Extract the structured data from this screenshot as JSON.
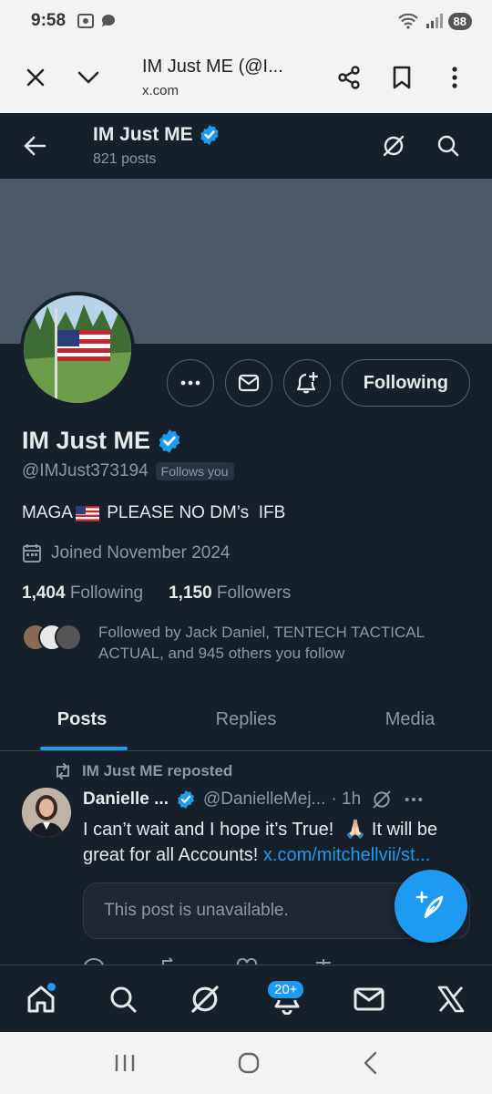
{
  "status_bar": {
    "time": "9:58",
    "battery": "88"
  },
  "browser": {
    "title": "IM Just ME (@I...",
    "url": "x.com"
  },
  "header": {
    "name": "IM Just ME",
    "posts": "821 posts"
  },
  "profile": {
    "name": "IM Just ME",
    "handle": "@IMJust373194",
    "follows_you": "Follows you",
    "bio_pre": "MAGA",
    "bio_post": " PLEASE NO DM’s  IFB",
    "joined": "Joined November 2024",
    "following_count": "1,404",
    "following_label": "Following",
    "followers_count": "1,150",
    "followers_label": "Followers",
    "followed_by": "Followed by Jack Daniel, TENTECH TACTICAL ACTUAL, and 945 others you follow",
    "follow_button": "Following"
  },
  "tabs": [
    "Posts",
    "Replies",
    "Media"
  ],
  "post": {
    "repost_label": "IM Just ME reposted",
    "author": "Danielle ...",
    "handle": "@DanielleMej...",
    "time": "· 1h",
    "text_a": "I can’t wait and I hope it’s True!  ",
    "text_b": " It will be great for all Accounts! ",
    "link": "x.com/mitchellvii/st...",
    "unavailable": "This post is unavailable."
  },
  "nav": {
    "notifications_badge": "20+"
  },
  "colors": {
    "background": "#15202b",
    "accent": "#1d9bf0",
    "secondary_text": "#8b98a5"
  }
}
